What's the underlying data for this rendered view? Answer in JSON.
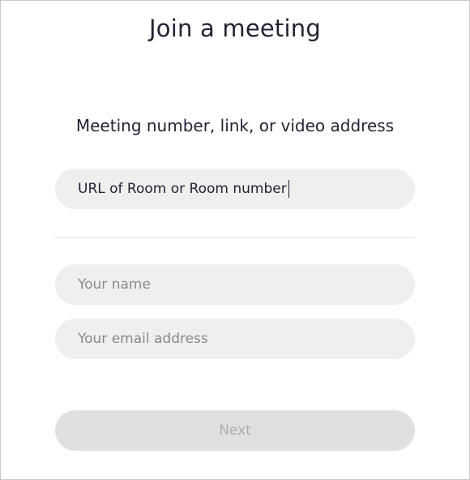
{
  "dialog": {
    "title": "Join a meeting",
    "subtitle": "Meeting number, link, or video address"
  },
  "fields": {
    "room_value": "URL of Room or Room number",
    "name_placeholder": "Your name",
    "email_placeholder": "Your email address"
  },
  "actions": {
    "next_label": "Next",
    "next_enabled": false
  },
  "colors": {
    "input_background": "#efefef",
    "button_disabled_background": "#e0e0e0",
    "button_disabled_text": "#adadad",
    "text_primary": "#232333",
    "placeholder_text": "#8a8a8a"
  }
}
